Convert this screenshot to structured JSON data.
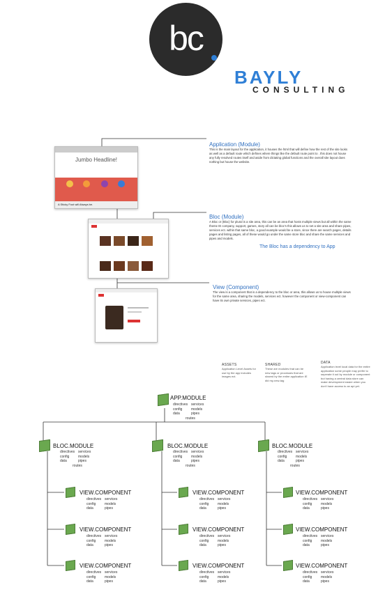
{
  "brand": {
    "logo_text": "bc",
    "name_primary": "BAYLY",
    "name_secondary": "CONSULTING"
  },
  "sections": [
    {
      "title": "Application (Module)",
      "body": "This is the main layout for the application, it houses the html that will define how the rest of the site looks as well as a default route which defines where things like the default route point to . this does not house any fully resolved routes itself and aside from dictating global functions and the overall site layout does nothing but house the website."
    },
    {
      "title": "Bloc (Module)",
      "body": "A Bloc or (Bloc) for plural is a site area, this can be an area that hosts multiple views but all within the same theme IE company, support, games, story all can be bloc's this allows us to set a  site area and share pipes, services ect. within that same bloc, a good example would be a store, since there are search pages, details pages and listing pages, all of these would go under the same store bloc and share the same services and pipes and models.",
      "note": "The Bloc has a dependency to App"
    },
    {
      "title": "View (Component)",
      "body": "The view is a component that is a dependency to the bloc or area, this allows us to house multiple views for the same area, sharing the models, services ect. however the component or view-component can have its own private services, pipes ect."
    }
  ],
  "screenshot1": {
    "headline": "Jumbo Headline!",
    "footer": "A Sticky Foot will Always be."
  },
  "legend": [
    {
      "heading": "ASSETS",
      "text": "Application Level Assets for use by the app includes images ect."
    },
    {
      "heading": "SHARED",
      "text": "These are modules that can be new tags or processes that are shared by the entire application IE did my-new-tag"
    },
    {
      "heading": "DATA",
      "text": "Application level local data for the entire application some people may prefer to seperate it out by module or component but having a central data store can make development easier when you don't have access to an api yet."
    }
  ],
  "app_module": {
    "title": "APP.MODULE",
    "items": [
      "directives",
      "services",
      "config",
      "models",
      "data",
      "pipes"
    ],
    "extra": "routes"
  },
  "bloc_module": {
    "title": "BLOC.MODULE",
    "items": [
      "directives",
      "services",
      "config",
      "models",
      "data",
      "pipes"
    ],
    "extra": "routes"
  },
  "view_component": {
    "title": "VIEW.COMPONENT",
    "items": [
      "directives",
      "services",
      "config",
      "models",
      "data",
      "pipes"
    ]
  },
  "colors": {
    "accent": "#2f7fd6",
    "module_green": "#6aa84f",
    "hero_red": "#e05a4c",
    "logo_dark": "#2b2b2b"
  }
}
